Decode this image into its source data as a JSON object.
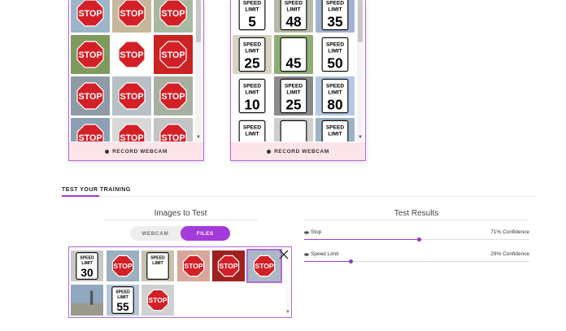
{
  "classes": [
    {
      "id": "stop",
      "record_label": "RECORD WEBCAM"
    },
    {
      "id": "speed",
      "record_label": "RECORD WEBCAM"
    }
  ],
  "stop_thumbs": [
    {
      "kind": "stop",
      "bg": "#9cb5c9"
    },
    {
      "kind": "stop",
      "bg": "#c7b79a"
    },
    {
      "kind": "stop",
      "bg": "#a8b9a2"
    },
    {
      "kind": "stop",
      "bg": "#7f9a5d"
    },
    {
      "kind": "stop",
      "bg": "#ffffff"
    },
    {
      "kind": "stop",
      "bg": "#cc2222"
    },
    {
      "kind": "stop",
      "bg": "#8e9aa6"
    },
    {
      "kind": "stop",
      "bg": "#b7c0c6"
    },
    {
      "kind": "stop",
      "bg": "#a7b0a0"
    },
    {
      "kind": "stop",
      "bg": "#8ca0b3"
    },
    {
      "kind": "stop",
      "bg": "#d8d8d8"
    },
    {
      "kind": "stop",
      "bg": "#c4c4c4"
    }
  ],
  "speed_thumbs": [
    {
      "line1": "SPEED",
      "line2": "LIMIT",
      "num": "5",
      "bg": "#ffffff"
    },
    {
      "line1": "SPEED",
      "line2": "LIMIT",
      "num": "48",
      "bg": "#b5bba8"
    },
    {
      "line1": "SPEED",
      "line2": "LIMIT",
      "num": "35",
      "bg": "#a3b2d1"
    },
    {
      "line1": "SPEED",
      "line2": "LIMIT",
      "num": "25",
      "bg": "#d7d2c4"
    },
    {
      "line1": "",
      "line2": "",
      "num": "45",
      "bg": "#8fae74"
    },
    {
      "line1": "SPEED",
      "line2": "LIMIT",
      "num": "50",
      "bg": "#ffffff"
    },
    {
      "line1": "SPEED",
      "line2": "LIMIT",
      "num": "10",
      "bg": "#ffffff"
    },
    {
      "line1": "SPEED",
      "line2": "LIMIT",
      "num": "25",
      "bg": "#8a8a8a"
    },
    {
      "line1": "SPEED",
      "line2": "LIMIT",
      "num": "80",
      "bg": "#b7c8e6"
    },
    {
      "line1": "SPEED",
      "line2": "LIMIT",
      "num": "",
      "bg": "#ffffff"
    },
    {
      "line1": "",
      "line2": "",
      "num": "",
      "bg": "#cfcfcf"
    },
    {
      "line1": "SPEED",
      "line2": "LIMIT",
      "num": "",
      "bg": "#9db3c6"
    }
  ],
  "section": {
    "title": "TEST YOUR TRAINING"
  },
  "images_to_test": {
    "heading": "Images to Test",
    "toggle": {
      "webcam": "WEBCAM",
      "files": "FILES",
      "active": "files"
    },
    "thumbs": [
      {
        "kind": "speed",
        "num": "30",
        "bg": "#c9c9c9"
      },
      {
        "kind": "stop",
        "bg": "#9bb0c0"
      },
      {
        "kind": "speed",
        "num": "",
        "bg": "#c7c1b0"
      },
      {
        "kind": "stop",
        "bg": "#d7a89a"
      },
      {
        "kind": "stop",
        "bg": "#a02020"
      },
      {
        "kind": "stop",
        "bg": "#aab8c6"
      },
      {
        "kind": "road",
        "bg": "#8fa7bf"
      },
      {
        "kind": "speed",
        "num": "55",
        "bg": "#b6c6da"
      },
      {
        "kind": "stop",
        "bg": "#d0d0d0"
      }
    ]
  },
  "results": {
    "heading": "Test Results",
    "items": [
      {
        "label": "Stop",
        "confidence_text": "71% Confidence",
        "confidence": 0.71
      },
      {
        "label": "Speed Limit",
        "confidence_text": "29% Confidence",
        "confidence": 0.29
      }
    ]
  },
  "colors": {
    "accent": "#a43ad9",
    "record_bg": "#fde3ea",
    "stop_red": "#d32027"
  }
}
